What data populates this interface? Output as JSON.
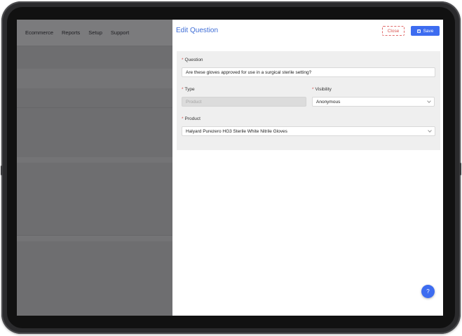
{
  "nav": {
    "items": [
      "Ecommerce",
      "Reports",
      "Setup",
      "Support"
    ]
  },
  "panel": {
    "title": "Edit Question",
    "close_label": "Close",
    "save_label": "Save"
  },
  "form": {
    "required_mark": "*",
    "question": {
      "label": "Question",
      "value": "Are these gloves approved for use in a surgical sterile setting?"
    },
    "type": {
      "label": "Type",
      "value": "Product"
    },
    "visibility": {
      "label": "Visibility",
      "value": "Anonymous"
    },
    "product": {
      "label": "Product",
      "value": "Halyard Purezero HG3 Sterile White Nitrile Gloves"
    }
  },
  "help": {
    "label": "?"
  },
  "colors": {
    "accent": "#3d6cf0",
    "title": "#3d6cd6",
    "danger": "#d9534f",
    "overlay": "#6e6e70"
  }
}
